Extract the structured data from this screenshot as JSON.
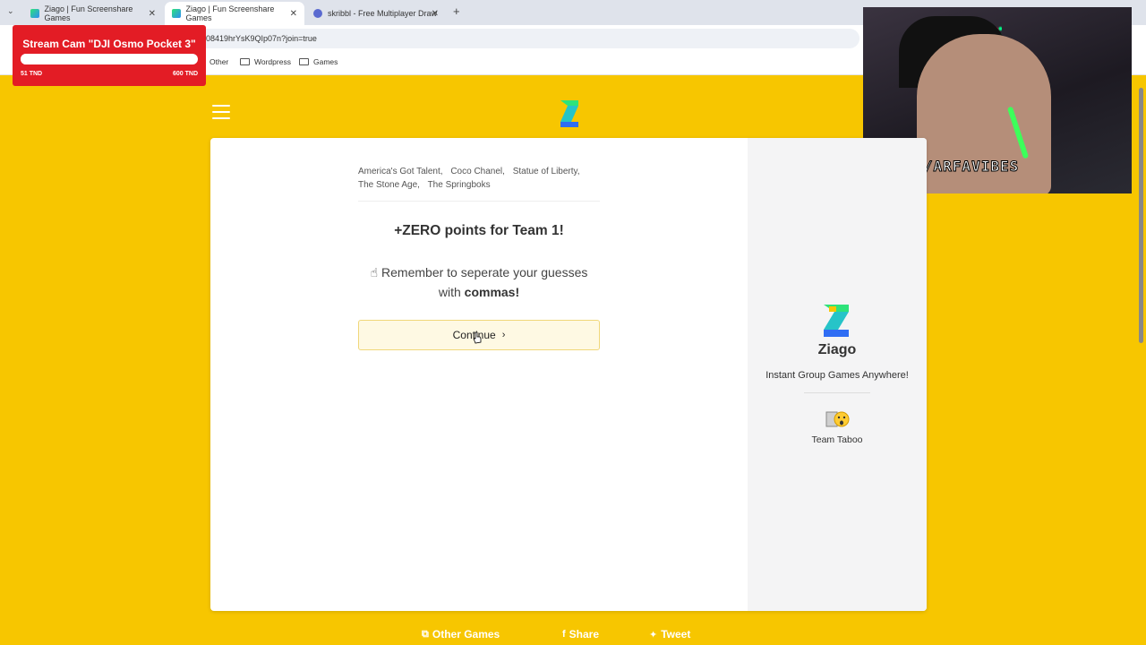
{
  "browser": {
    "tabs": [
      {
        "title": "Ziago | Fun Screenshare Games",
        "active": false
      },
      {
        "title": "Ziago | Fun Screenshare Games",
        "active": true
      },
      {
        "title": "skribbl - Free Multiplayer Draw",
        "active": false
      }
    ],
    "url": "08419hrYsK9QIp07n?join=true",
    "bookmarks": [
      "Other",
      "Wordpress",
      "Games"
    ]
  },
  "overlay": {
    "goal_title": "Stream Cam \"DJI Osmo Pocket 3\"",
    "goal_current": "51 TND",
    "goal_target": "600 TND",
    "goal_progress": 0.085,
    "webcam_tag": "ICK/ARFAVIBES"
  },
  "game": {
    "answers": [
      "America's Got Talent,",
      "Coco Chanel,",
      "Statue of Liberty,",
      "The Stone Age,",
      "The Springboks"
    ],
    "points_text": "+ZERO points for Team 1!",
    "reminder_prefix": "Remember to seperate your guesses with",
    "reminder_bold": "commas!",
    "continue_label": "Continue"
  },
  "sidebar": {
    "brand": "Ziago",
    "tagline": "Instant Group Games Anywhere!",
    "game_name": "Team Taboo"
  },
  "footer": {
    "other_games": "Other Games",
    "share": "Share",
    "tweet": "Tweet"
  },
  "colors": {
    "background": "#f7c600",
    "donation": "#e31c25",
    "button_bg": "#fef9e3"
  }
}
